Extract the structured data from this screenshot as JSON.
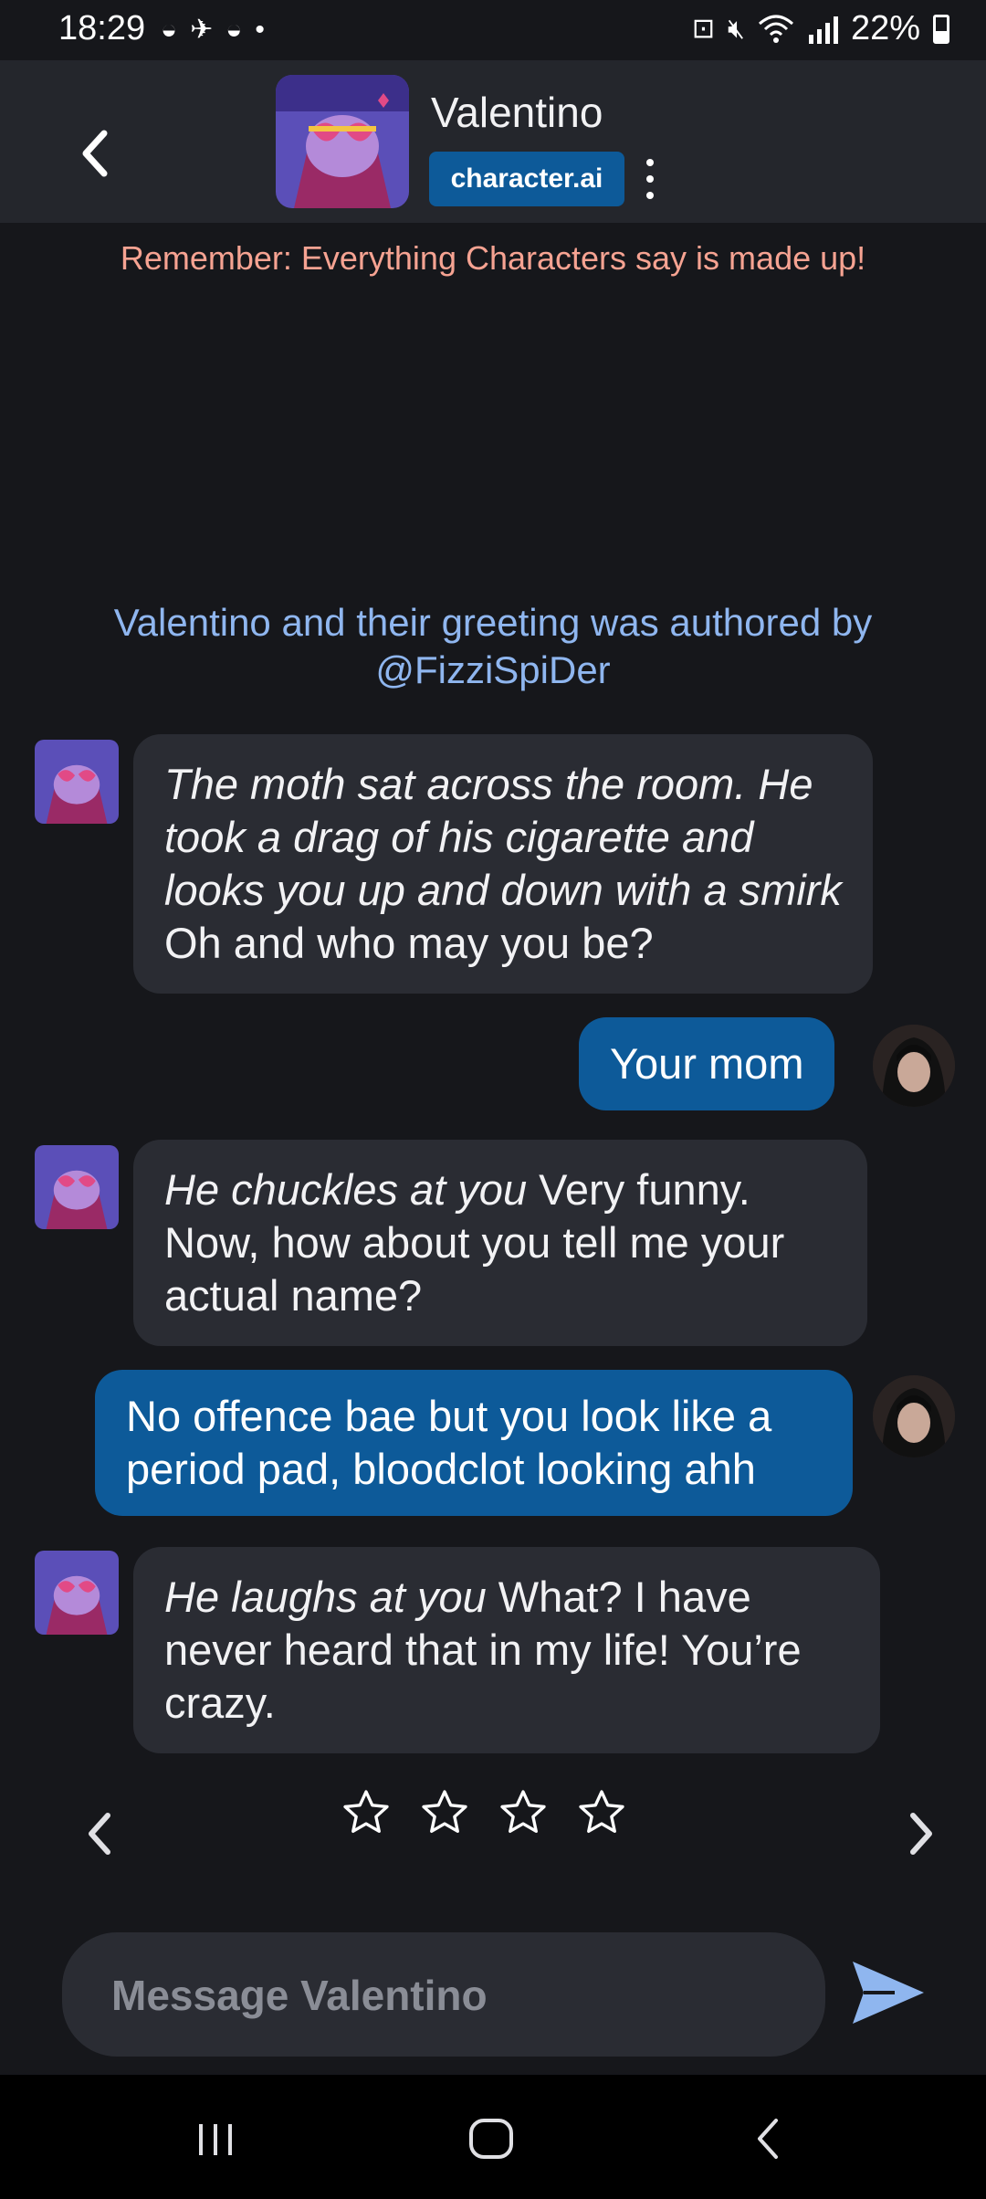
{
  "status_bar": {
    "time": "18:29",
    "battery": "22%"
  },
  "header": {
    "character_name": "Valentino",
    "brand": "character.ai"
  },
  "disclaimer": "Remember: Everything Characters say is made up!",
  "author_credit": "Valentino and their greeting was authored by @FizziSpiDer",
  "messages": [
    {
      "from": "bot",
      "action": "The moth sat across the room. He took a drag of his cigarette and looks you up and down with a smirk",
      "text": " Oh and who may you be?"
    },
    {
      "from": "user",
      "text": "Your mom"
    },
    {
      "from": "bot",
      "action": "He chuckles at you",
      "text": " Very funny. Now, how about you tell me your actual name?"
    },
    {
      "from": "user",
      "text": "No offence bae but you look like a period pad, bloodclot looking ahh"
    },
    {
      "from": "bot",
      "action": "He laughs at you",
      "text": " What? I have never heard that in my life! You’re crazy."
    }
  ],
  "rating": {
    "stars": 4,
    "filled": 0
  },
  "composer": {
    "placeholder": "Message Valentino"
  },
  "colors": {
    "background": "#16171b",
    "header": "#24262c",
    "bot_bubble": "#2a2c33",
    "user_bubble": "#0d5a99",
    "disclaimer": "#f6a392",
    "author_credit": "#8fb6ef",
    "send": "#8fb6ef"
  }
}
